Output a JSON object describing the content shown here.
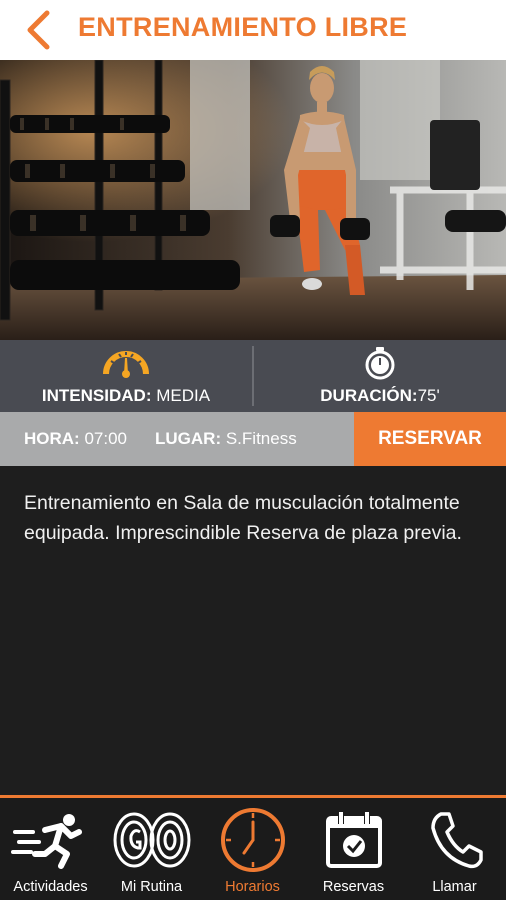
{
  "header": {
    "title": "ENTRENAMIENTO LIBRE",
    "back_icon": "chevron-left-icon"
  },
  "colors": {
    "accent": "#ee7a32",
    "stats_bg": "#494b52",
    "info_bg": "#a9aaab",
    "body_bg": "#1e1e1e"
  },
  "stats": {
    "intensity_label": "INTENSIDAD:",
    "intensity_value": "MEDIA",
    "intensity_icon": "gauge-icon",
    "duration_label": "DURACIÓN:",
    "duration_value": "75'",
    "duration_icon": "stopwatch-icon"
  },
  "info": {
    "hora_label": "HORA:",
    "hora_value": "07:00",
    "lugar_label": "LUGAR:",
    "lugar_value": "S.Fitness",
    "reserve_label": "RESERVAR"
  },
  "description": "Entrenamiento en Sala de musculación totalmente equipada. Imprescindible Reserva de plaza previa.",
  "nav": {
    "items": [
      {
        "label": "Actividades",
        "icon": "running-icon",
        "active": false
      },
      {
        "label": "Mi Rutina",
        "icon": "weights-icon",
        "active": false
      },
      {
        "label": "Horarios",
        "icon": "clock-icon",
        "active": true
      },
      {
        "label": "Reservas",
        "icon": "calendar-check-icon",
        "active": false
      },
      {
        "label": "Llamar",
        "icon": "phone-icon",
        "active": false
      }
    ]
  }
}
